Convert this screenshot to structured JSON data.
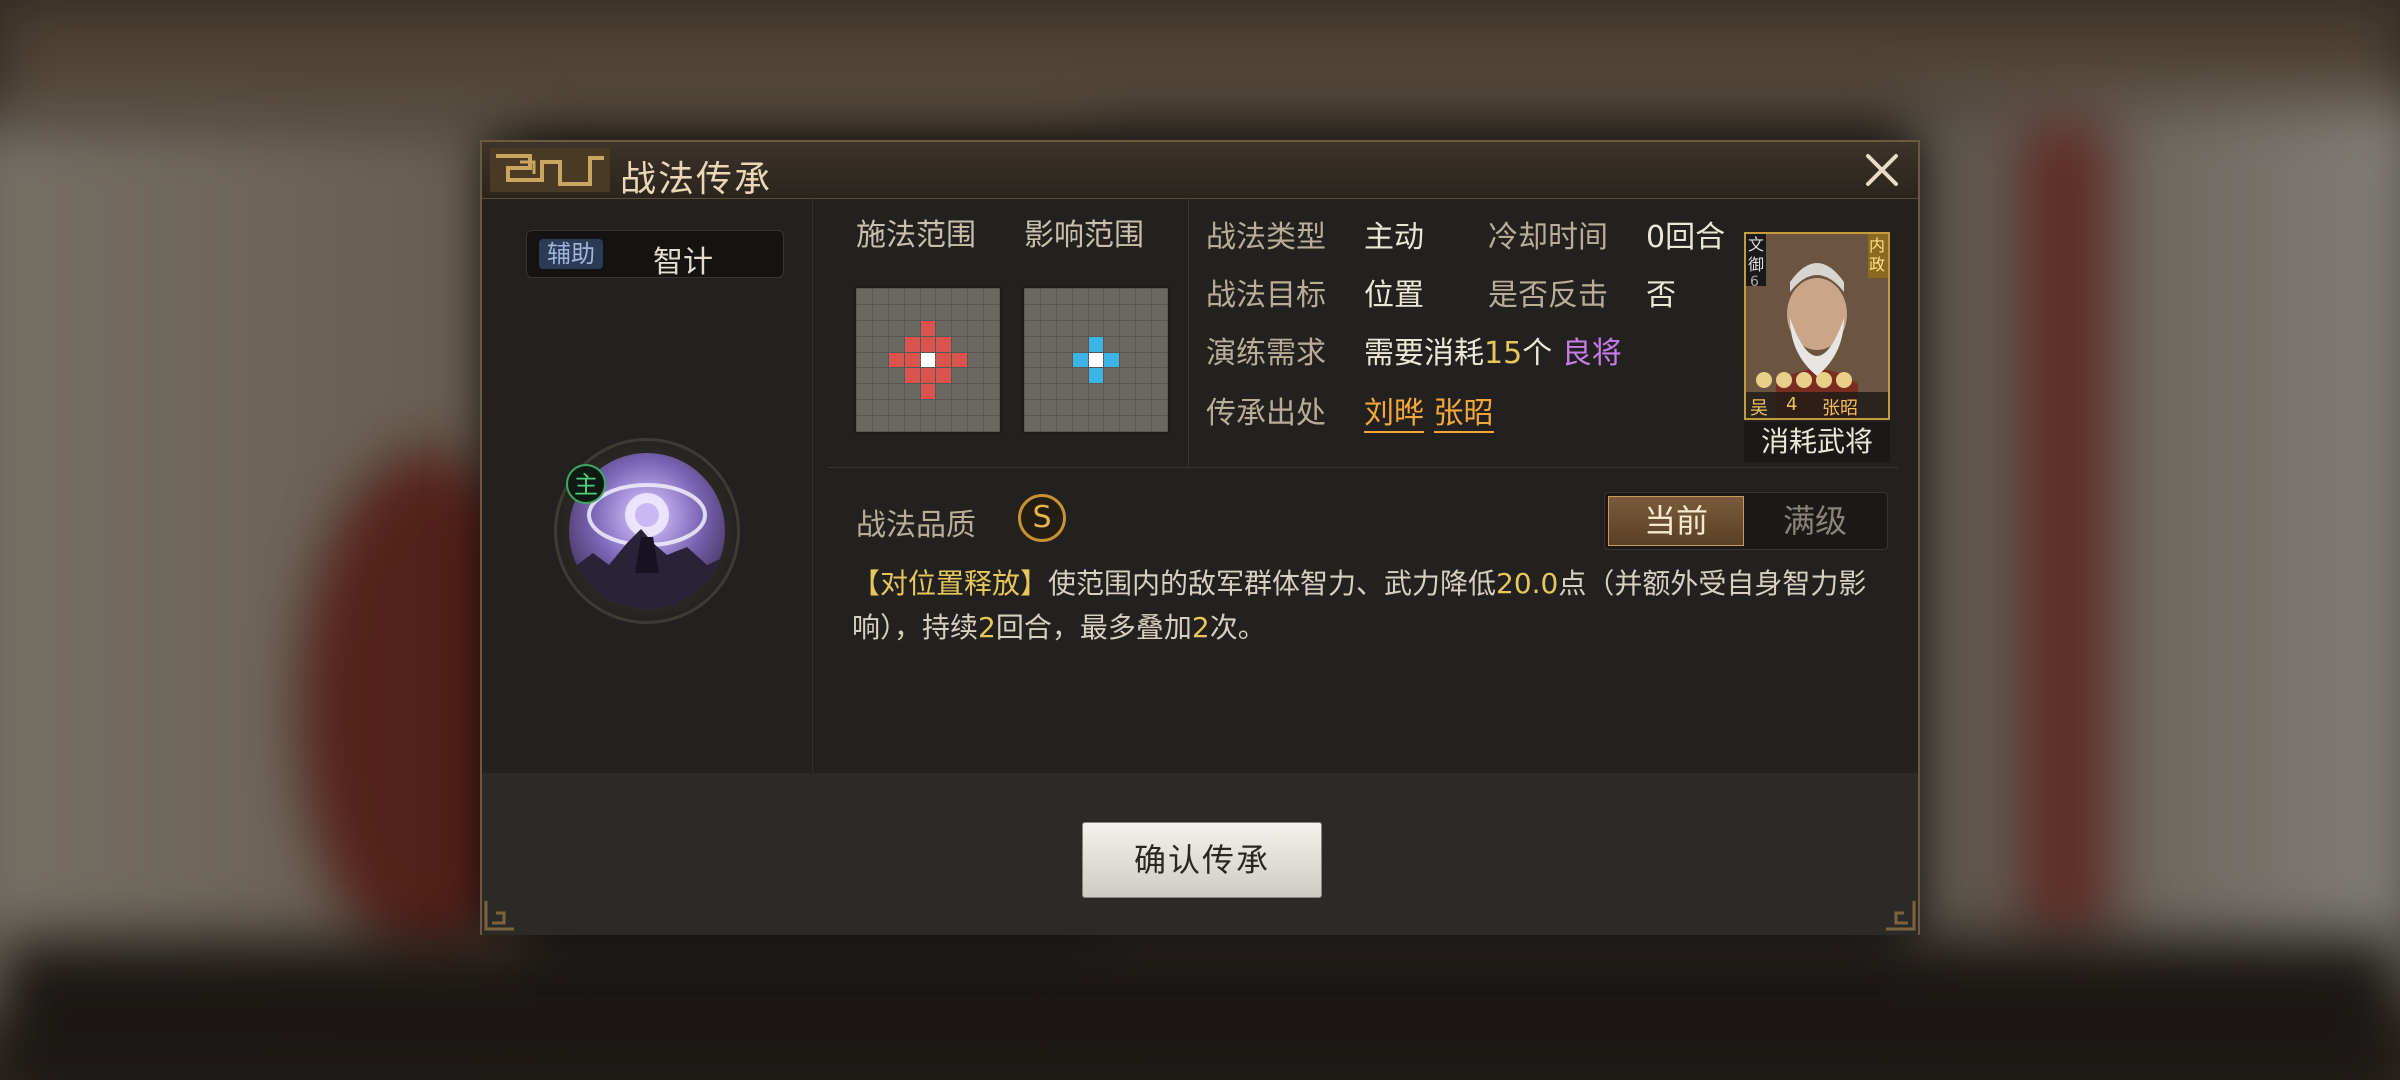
{
  "dialog": {
    "title": "战法传承",
    "type_tag": "辅助",
    "type_name": "智计",
    "main_tag": "主",
    "cast_range_label": "施法范围",
    "effect_range_label": "影响范围",
    "info": {
      "skill_type_label": "战法类型",
      "skill_type_value": "主动",
      "cooldown_label": "冷却时间",
      "cooldown_value": "0回合",
      "target_label": "战法目标",
      "target_value": "位置",
      "counter_label": "是否反击",
      "counter_value": "否",
      "requirement_label": "演练需求",
      "requirement_prefix": "需要消耗",
      "requirement_count": "15",
      "requirement_unit": "个",
      "requirement_quality": "良将",
      "source_label": "传承出处",
      "source_general_1": "刘晔",
      "source_general_2": "张昭"
    },
    "portrait": {
      "caption": "消耗武将",
      "left_tag_top": "文",
      "left_tag_bottom": "御",
      "left_tag_num": "6",
      "right_tag": "内政",
      "faction": "吴",
      "cost": "4",
      "name": "张昭",
      "stars": 5
    },
    "quality_label": "战法品质",
    "quality_value": "S",
    "toggle": {
      "current": "当前",
      "max": "满级"
    },
    "description": {
      "tag": "【对位置释放】",
      "text1": "使范围内的敌军群体智力、武力降低",
      "value1": "20.0",
      "text2": "点（并额外受自身智力影响），持续",
      "value2": "2",
      "text3": "回合，最多叠加",
      "value3": "2",
      "text4": "次。"
    },
    "confirm_label": "确认传承"
  },
  "colors": {
    "accent_gold": "#c79b3a",
    "highlight_yellow": "#e7c65a",
    "highlight_purple": "#c77ce8",
    "highlight_orange": "#f3a73a",
    "cast_color": "#d9534f",
    "effect_color": "#3cb4e6"
  },
  "grids": {
    "cast": {
      "size": 9,
      "center": [
        4,
        4
      ],
      "cells_red": [
        [
          2,
          4
        ],
        [
          3,
          3
        ],
        [
          3,
          4
        ],
        [
          3,
          5
        ],
        [
          4,
          2
        ],
        [
          4,
          3
        ],
        [
          4,
          5
        ],
        [
          4,
          6
        ],
        [
          5,
          3
        ],
        [
          5,
          4
        ],
        [
          5,
          5
        ],
        [
          6,
          4
        ]
      ]
    },
    "effect": {
      "size": 9,
      "center": [
        4,
        4
      ],
      "cells_blue": [
        [
          3,
          4
        ],
        [
          4,
          3
        ],
        [
          4,
          5
        ],
        [
          5,
          4
        ]
      ]
    }
  }
}
